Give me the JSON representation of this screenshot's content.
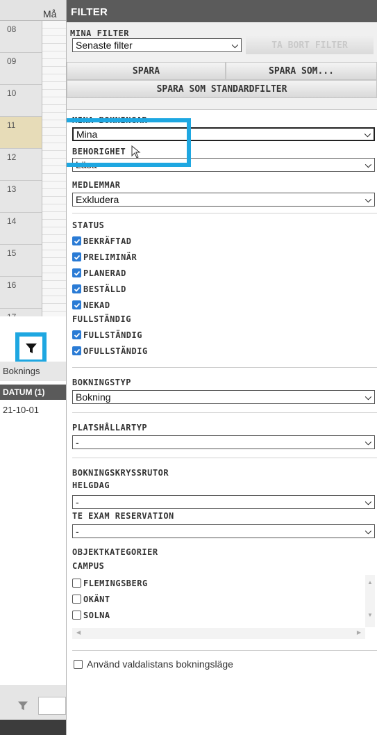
{
  "calendar": {
    "day_header": "Må",
    "hours": [
      "08",
      "09",
      "10",
      "11",
      "12",
      "13",
      "14",
      "15",
      "16",
      "17"
    ],
    "highlighted_hour": "11"
  },
  "bottom_left": {
    "tab_label": "Boknings",
    "column_header": "DATUM (1)",
    "cell_value": "21-10-01"
  },
  "filter": {
    "title": "FILTER",
    "mina_filter": {
      "label": "MINA FILTER",
      "selected": "Senaste filter",
      "delete_button": "TA BORT FILTER",
      "save_button": "SPARA",
      "save_as_button": "SPARA SOM...",
      "save_default_button": "SPARA SOM STANDARDFILTER"
    },
    "mina_bokningar": {
      "label": "MINA BOKNINGAR",
      "selected": "Mina"
    },
    "behorighet": {
      "label": "BEHORIGHET",
      "selected": "Läsa"
    },
    "medlemmar": {
      "label": "MEDLEMMAR",
      "selected": "Exkludera"
    },
    "status": {
      "label": "STATUS",
      "options": [
        "BEKRÄFTAD",
        "PRELIMINÄR",
        "PLANERAD",
        "BESTÄLLD",
        "NEKAD"
      ]
    },
    "fullstandig": {
      "label": "FULLSTÄNDIG",
      "options": [
        "FULLSTÄNDIG",
        "OFULLSTÄNDIG"
      ]
    },
    "bokningstyp": {
      "label": "BOKNINGSTYP",
      "selected": "Bokning"
    },
    "platshallartyp": {
      "label": "PLATSHÅLLARTYP",
      "selected": "-"
    },
    "bokningskryssrutor": {
      "label": "BOKNINGSKRYSSRUTOR",
      "helgdag_label": "HELGDAG",
      "helgdag_selected": "-",
      "te_exam_label": "TE EXAM RESERVATION",
      "te_exam_selected": "-"
    },
    "objektkategorier": {
      "label": "OBJEKTKATEGORIER",
      "campus_label": "CAMPUS",
      "campus_options": [
        "FLEMINGSBERG",
        "OKÄNT",
        "SOLNA"
      ]
    },
    "footer_checkbox": "Använd valdalistans bokningsläge"
  },
  "colors": {
    "highlight": "#1ea7e1",
    "checkbox": "#2a7bd5",
    "header_bg": "#5b5b5b"
  }
}
